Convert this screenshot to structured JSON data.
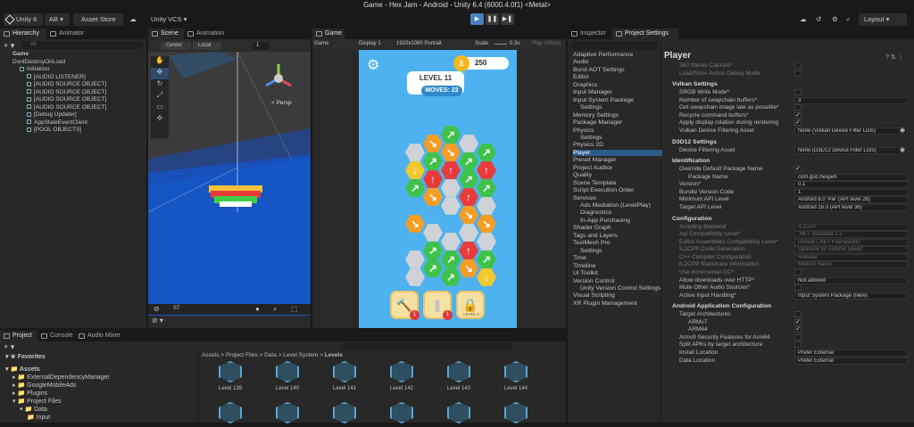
{
  "window": {
    "title": "Game - Hex Jam - Android - Unity 6.4 (6000.4.0f1) <Metal>"
  },
  "toolbar": {
    "unity": "Unity 6",
    "account": "AB",
    "asset_store": "Asset Store",
    "vcs": "Unity VCS",
    "layout": "Layout",
    "play_icons": [
      "▶",
      "❚❚",
      "▶❚"
    ]
  },
  "hierarchy": {
    "tabs": [
      "Hierarchy",
      "Animator"
    ],
    "search": "All",
    "items": [
      "Game",
      "DontDestroyOnLoad",
      "Initializer",
      "[AUDIO LISTENER]",
      "[AUDIO SOURCE OBJECT]",
      "[AUDIO SOURCE OBJECT]",
      "[AUDIO SOURCE OBJECT]",
      "[AUDIO SOURCE OBJECT]",
      "[Debug Updater]",
      "AppStateEventClient",
      "[POOL OBJECTS]"
    ]
  },
  "scene": {
    "tabs": [
      "Scene",
      "Animation"
    ],
    "pivot": "Center",
    "space": "Local",
    "snap": "1",
    "persp": "< Persp",
    "bottom_tools": [
      "ST"
    ]
  },
  "game_view": {
    "tab": "Game",
    "mode": "Game",
    "display": "Display 1",
    "resolution": "1920x1080 Portrait",
    "scale_label": "Scale",
    "scale": "0.3x",
    "play_unfocused": "Play Unfocu"
  },
  "game": {
    "coins": "250",
    "level": "LEVEL 11",
    "moves": "MOVES: 22",
    "powerups": [
      "1",
      "1",
      "LEVEL 8"
    ]
  },
  "inspector": {
    "tabs": [
      "Inspector",
      "Project Settings"
    ],
    "title": "Player",
    "categories": [
      "Adaptive Performance",
      "Audio",
      "Burst AOT Settings",
      "Editor",
      "Graphics",
      "Input Manager",
      "Input System Package",
      "Settings",
      "Memory Settings",
      "Package Manager",
      "Physics",
      "Settings",
      "Physics 2D",
      "Player",
      "Preset Manager",
      "Project Auditor",
      "Quality",
      "Scene Template",
      "Script Execution Order",
      "Services",
      "Ads Mediation (LevelPlay)",
      "Diagnostics",
      "In-App Purchasing",
      "Shader Graph",
      "Tags and Layers",
      "TextMesh Pro",
      "Settings",
      "Time",
      "Timeline",
      "UI Toolkit",
      "Version Control",
      "Unity Version Control Settings",
      "Visual Scripting",
      "XR Plugin Management"
    ],
    "settings": [
      {
        "t": "lbl",
        "d": true,
        "text": "360 Stereo Capture*"
      },
      {
        "t": "lbl",
        "d": true,
        "text": "Load/Store Action Debug Mode"
      },
      {
        "t": "hdr",
        "text": "Vulkan Settings"
      },
      {
        "t": "lbl",
        "text": "SRGB Write Mode*"
      },
      {
        "t": "lbl",
        "text": "Number of swapchain buffers*",
        "v": "3"
      },
      {
        "t": "lbl",
        "text": "Get swapchain image late as possible*"
      },
      {
        "t": "lbl",
        "text": "Recycle command buffers*",
        "c": "✓"
      },
      {
        "t": "lbl",
        "text": "Apply display rotation during rendering",
        "c": "✓"
      },
      {
        "t": "lbl",
        "text": "Vulkan Device Filtering Asset",
        "v": "None (Vulkan Device Filter Lists)",
        "o": "◉"
      },
      {
        "t": "hdr",
        "text": "D3D12 Settings"
      },
      {
        "t": "lbl",
        "text": "Device Filtering Asset",
        "v": "None (D3D12 Device Filter Lists)",
        "o": "◉"
      },
      {
        "t": "hdr",
        "text": "Identification"
      },
      {
        "t": "lbl",
        "text": "Override Default Package Name",
        "c": "✓"
      },
      {
        "t": "lbl",
        "i": true,
        "text": "Package Name",
        "v": "com.guc.hexjam"
      },
      {
        "t": "lbl",
        "text": "Version*",
        "v": "0.1"
      },
      {
        "t": "lbl",
        "text": "Bundle Version Code",
        "v": "1"
      },
      {
        "t": "lbl",
        "text": "Minimum API Level",
        "v": "Android 8.0 'Pie' (API level 28)"
      },
      {
        "t": "lbl",
        "text": "Target API Level",
        "v": "Android 16.0 (API level 36)"
      },
      {
        "t": "hdr",
        "text": "Configuration"
      },
      {
        "t": "lbl",
        "d": true,
        "text": "Scripting Backend",
        "v": "IL2CPP",
        "vd": true
      },
      {
        "t": "lbl",
        "d": true,
        "text": "Api Compatibility Level*",
        "v": ".NET Standard 2.1",
        "vd": true
      },
      {
        "t": "lbl",
        "d": true,
        "text": "Editor Assemblies Compatibility Level*",
        "v": "Default (.NET Framework)",
        "vd": true
      },
      {
        "t": "lbl",
        "d": true,
        "text": "IL2CPP Code Generation",
        "v": "Optimize for runtime speed",
        "vd": true
      },
      {
        "t": "lbl",
        "d": true,
        "text": "C++ Compiler Configuration",
        "v": "Release",
        "vd": true
      },
      {
        "t": "lbl",
        "d": true,
        "text": "IL2CPP Stacktrace Information",
        "v": "Method Name",
        "vd": true
      },
      {
        "t": "lbl",
        "d": true,
        "text": "Use incremental GC*"
      },
      {
        "t": "lbl",
        "text": "Allow downloads over HTTP*",
        "v": "Not allowed"
      },
      {
        "t": "lbl",
        "text": "Mute Other Audio Sources*"
      },
      {
        "t": "lbl",
        "text": "Active Input Handling*",
        "v": "Input System Package (New)"
      },
      {
        "t": "hdr",
        "text": "Android Application Configuration"
      },
      {
        "t": "lbl",
        "text": "Target Architectures"
      },
      {
        "t": "lbl",
        "i": true,
        "text": "ARMv7",
        "c": "✓"
      },
      {
        "t": "lbl",
        "i": true,
        "text": "ARM64",
        "c": "✓"
      },
      {
        "t": "lbl",
        "text": "Armv9 Security Features for Arm64"
      },
      {
        "t": "lbl",
        "text": "Split APKs by target architecture"
      },
      {
        "t": "lbl",
        "text": "Install Location",
        "v": "Prefer External"
      },
      {
        "t": "lbl",
        "text": "Data Location",
        "v": "Prefer External"
      }
    ]
  },
  "project": {
    "tabs": [
      "Project",
      "Console",
      "Audio Mixer"
    ],
    "favorites": "Favorites",
    "tree": [
      "Assets",
      "ExternalDependencyManager",
      "GoogleMobileAds",
      "Plugins",
      "Project Files",
      "Data",
      "Input"
    ],
    "breadcrumb": [
      "Assets",
      "Project Files",
      "Data",
      "Level System",
      "Levels"
    ],
    "assets": [
      "Level 139",
      "Level 140",
      "Level 141",
      "Level 142",
      "Level 143",
      "Level 144"
    ]
  }
}
